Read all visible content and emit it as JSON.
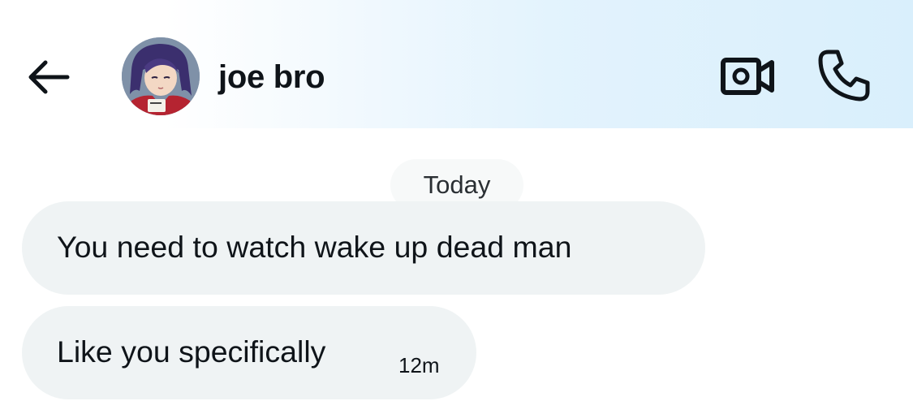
{
  "header": {
    "contact_name": "joe bro",
    "icons": {
      "back": "arrow-left-icon",
      "video": "video-camera-icon",
      "call": "phone-icon"
    }
  },
  "conversation": {
    "date_separator": "Today",
    "messages": [
      {
        "text": "You need to watch wake up dead man",
        "time": ""
      },
      {
        "text": "Like you specifically",
        "time": "12m"
      }
    ]
  },
  "colors": {
    "bubble_background": "#eff3f4",
    "date_pill_background": "#f7f9f9",
    "header_gradient_end": "#d9effc",
    "text": "#0f1419"
  }
}
